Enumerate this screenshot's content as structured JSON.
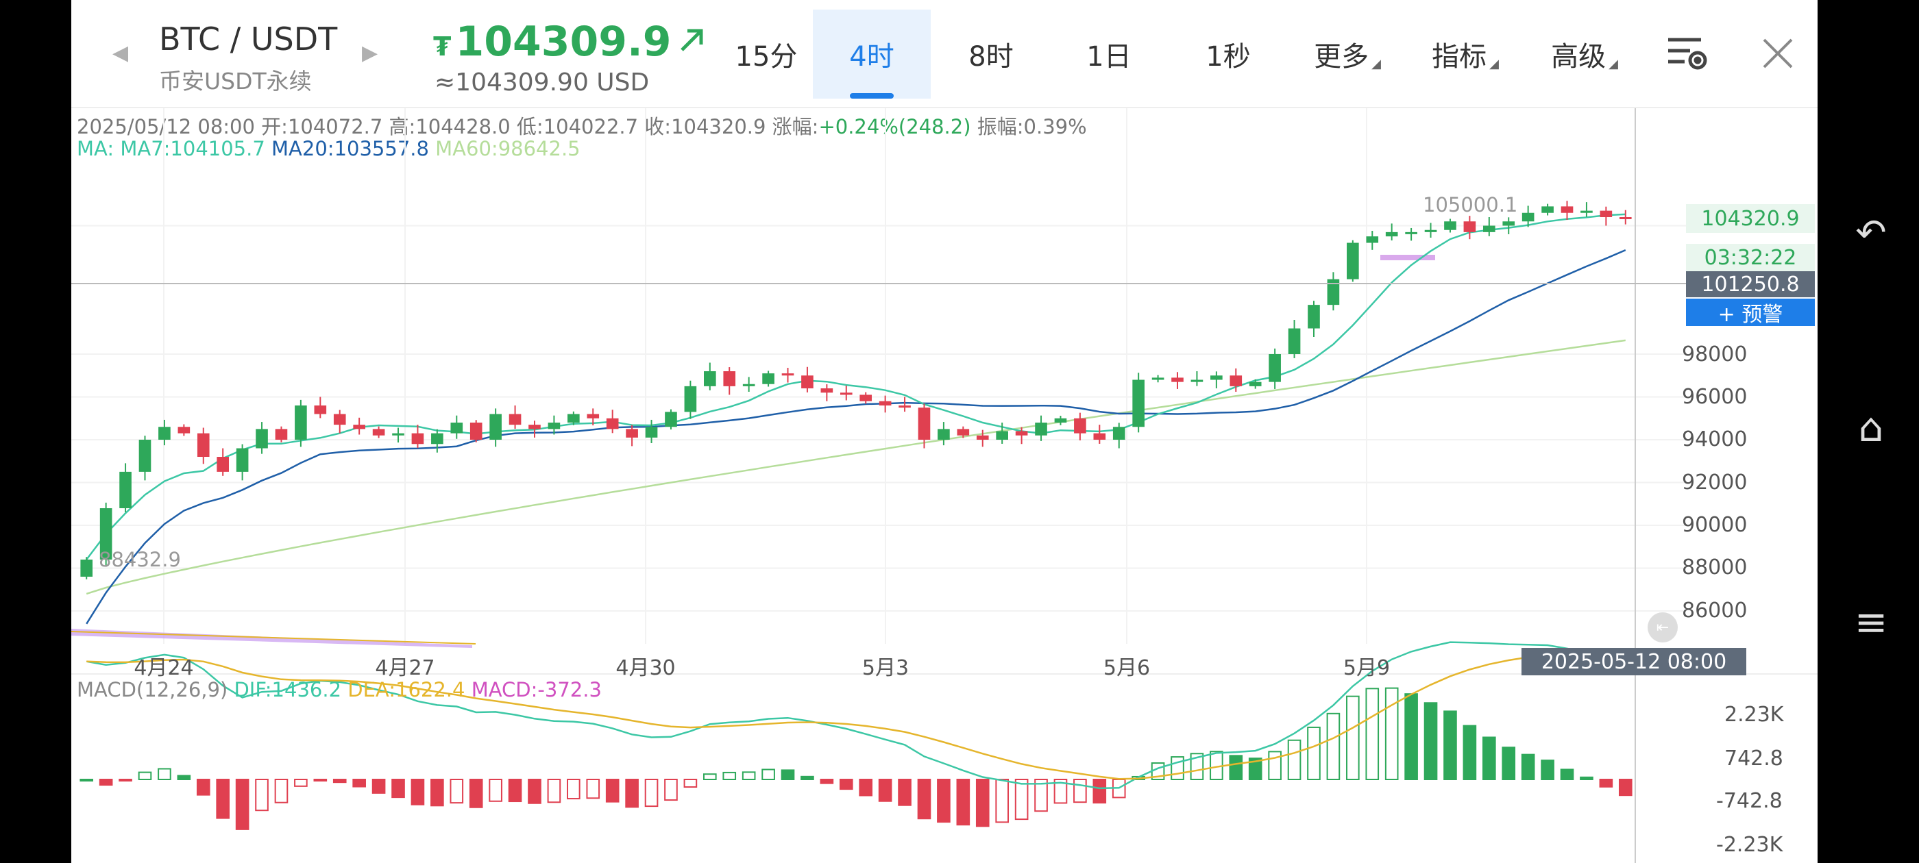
{
  "header": {
    "symbol": "BTC / USDT",
    "market": "币安USDT永续",
    "price": "104309.9",
    "price_prefix": "₮",
    "price_usd": "≈104309.90 USD",
    "price_color": "#2ea85a"
  },
  "tabs": [
    {
      "label": "15分"
    },
    {
      "label": "4时",
      "active": true
    },
    {
      "label": "8时"
    },
    {
      "label": "1日"
    },
    {
      "label": "1秒"
    },
    {
      "label": "更多",
      "dropdown": true
    },
    {
      "label": "指标",
      "dropdown": true
    },
    {
      "label": "高级",
      "dropdown": true
    }
  ],
  "ohlc": {
    "date": "2025/05/12 08:00",
    "open_label": "开:",
    "open": "104072.7",
    "high_label": "高:",
    "high": "104428.0",
    "low_label": "低:",
    "low": "104022.7",
    "close_label": "收:",
    "close": "104320.9",
    "change_label": "涨幅:",
    "change": "+0.24%(248.2)",
    "amp_label": "振幅:",
    "amp": "0.39%"
  },
  "ma": {
    "prefix": "MA:",
    "ma7": "MA7:104105.7",
    "ma20": "MA20:103557.8",
    "ma60": "MA60:98642.5",
    "colors": {
      "ma7": "#3cc7a5",
      "ma20": "#1f5fa8",
      "ma60": "#b5dd9a"
    }
  },
  "price_axis": {
    "ticks": [
      "98000",
      "96000",
      "94000",
      "92000",
      "90000",
      "88000",
      "86000"
    ],
    "current_price": "104320.9",
    "countdown": "03:32:22",
    "crosshair_price": "101250.8",
    "alert_button": "+ 预警",
    "max_label": "105000.1",
    "min_label": "88432.9"
  },
  "time_axis": {
    "labels": [
      "4月24",
      "4月27",
      "4月30",
      "5月3",
      "5月6",
      "5月9"
    ],
    "crosshair_time": "2025-05-12 08:00"
  },
  "macd": {
    "title": "MACD(12,26,9)",
    "dif": "DIF:1436.2",
    "dea": "DEA:1622.4",
    "macd": "MACD:-372.3",
    "ticks": [
      "2.23K",
      "742.8",
      "-742.8",
      "-2.23K"
    ],
    "colors": {
      "dif": "#3cc7a5",
      "dea": "#e5b52c",
      "macd": "#d050c0"
    }
  },
  "chart_data": {
    "type": "candlestick",
    "timeframe": "4h",
    "ylim": [
      85000,
      106000
    ],
    "up_color": "#2ea85a",
    "down_color": "#e04050",
    "closes_approx": [
      88400,
      90800,
      92500,
      94000,
      94600,
      94300,
      93200,
      92500,
      93600,
      94500,
      94000,
      95600,
      95200,
      94700,
      94500,
      94200,
      94300,
      93800,
      94300,
      94800,
      94000,
      95200,
      94700,
      94500,
      94800,
      95200,
      95000,
      94500,
      94100,
      94600,
      95300,
      96500,
      97200,
      96500,
      96600,
      97100,
      97000,
      96400,
      96200,
      96100,
      95800,
      95600,
      95500,
      94000,
      94500,
      94200,
      94000,
      94400,
      94200,
      94800,
      95000,
      94300,
      94000,
      94600,
      96800,
      96900,
      96700,
      96800,
      97000,
      96500,
      96700,
      98000,
      99200,
      100300,
      101500,
      103200,
      103500,
      103700,
      103700,
      103800,
      104200,
      103700,
      104000,
      104200,
      104600,
      104900,
      104600,
      104700,
      104400,
      104320
    ]
  },
  "nav": {
    "back": "↶",
    "home": "⌂",
    "menu": "≡"
  }
}
